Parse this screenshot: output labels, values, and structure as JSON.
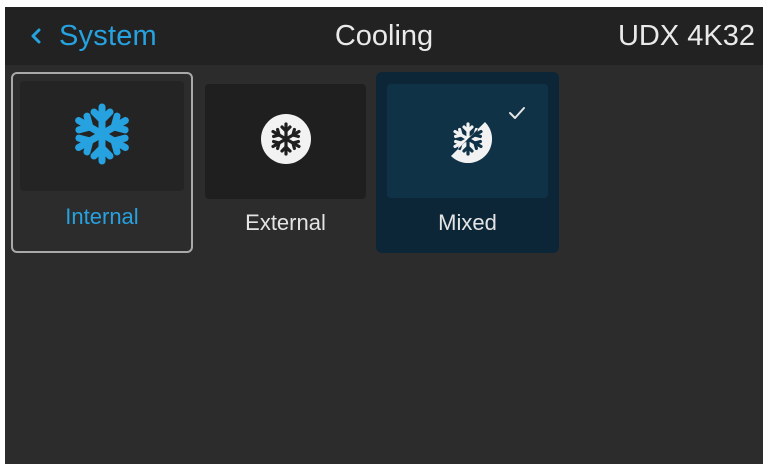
{
  "header": {
    "back_label": "System",
    "back_icon": "chevron-left-icon",
    "title": "Cooling",
    "model": "UDX 4K32"
  },
  "options": [
    {
      "label": "Internal",
      "icon": "snowflake-icon",
      "state": "focused"
    },
    {
      "label": "External",
      "icon": "snowflake-circle-icon",
      "state": "normal"
    },
    {
      "label": "Mixed",
      "icon": "snowflake-half-circle-icon",
      "state": "selected"
    }
  ],
  "selected_indicator_icon": "checkmark-icon",
  "colors": {
    "accent": "#27a2e0",
    "background": "#2c2c2c",
    "header_background": "#222222",
    "selected_tile": "#0c2638",
    "text": "#e4e4e4"
  }
}
